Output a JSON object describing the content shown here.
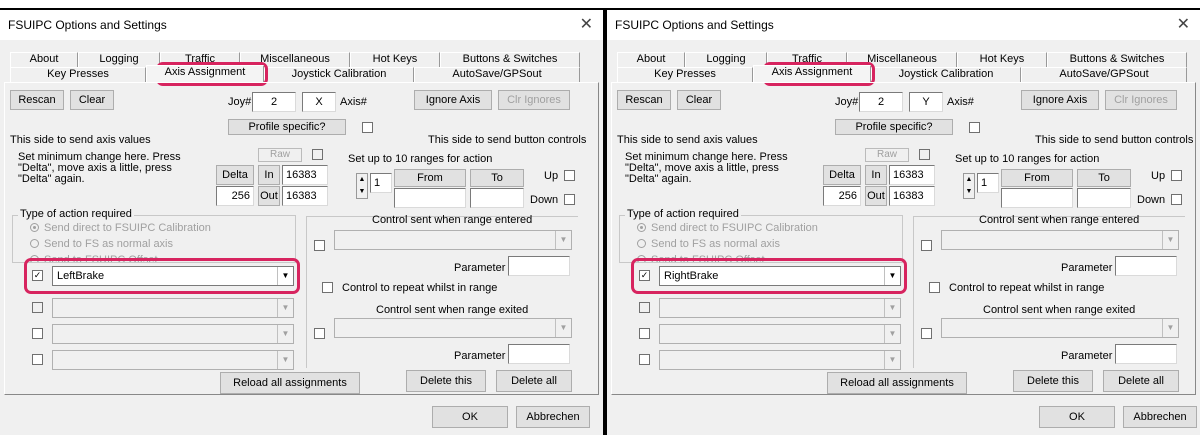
{
  "title": "FSUIPC Options and Settings",
  "close_glyph": "✕",
  "tabs_row1": [
    "About",
    "Logging",
    "Traffic",
    "Miscellaneous",
    "Hot Keys",
    "Buttons & Switches"
  ],
  "tabs_row2": [
    "Key Presses",
    "Axis Assignment",
    "Joystick Calibration",
    "AutoSave/GPSout"
  ],
  "buttons": {
    "rescan": "Rescan",
    "clear": "Clear",
    "ignore_axis": "Ignore Axis",
    "clr_ignores": "Clr Ignores",
    "profile": "Profile specific?",
    "reload": "Reload all assignments",
    "delete_this": "Delete this",
    "delete_all": "Delete all",
    "ok": "OK",
    "cancel": "Abbrechen"
  },
  "labels": {
    "joy": "Joy#",
    "axis": "Axis#",
    "send_axis": "This side to send axis values",
    "send_button": "This side to send button controls",
    "min_change": "Set minimum change  here.  Press \"Delta\", move axis a little,  press \"Delta\" again.",
    "raw": "Raw",
    "delta": "Delta",
    "in": "In",
    "out": "Out",
    "ranges": "Set up to 10 ranges for action",
    "from": "From",
    "to": "To",
    "up": "Up",
    "down": "Down",
    "type_action": "Type of action required",
    "opt_direct": "Send direct to FSUIPC Calibration",
    "opt_normal": "Send to FS as normal axis",
    "opt_offset": "Send to FSUIPC Offset",
    "ctrl_entered": "Control sent when range entered",
    "parameter": "Parameter",
    "repeat": "Control to repeat whilst in range",
    "ctrl_exited": "Control sent when range exited"
  },
  "left": {
    "joy_num": "2",
    "axis_letter": "X",
    "delta_value": "256",
    "in_value": "16383",
    "out_value": "16383",
    "range_num": "1",
    "assigned_control": "LeftBrake",
    "assigned_checked": true
  },
  "right": {
    "joy_num": "2",
    "axis_letter": "Y",
    "delta_value": "256",
    "in_value": "16383",
    "out_value": "16383",
    "range_num": "1",
    "assigned_control": "RightBrake",
    "assigned_checked": true
  },
  "highlight_color": "#d7245f",
  "icons": {
    "close": "close-icon",
    "dropdown": "chevron-down-icon",
    "check": "checkmark-icon"
  }
}
